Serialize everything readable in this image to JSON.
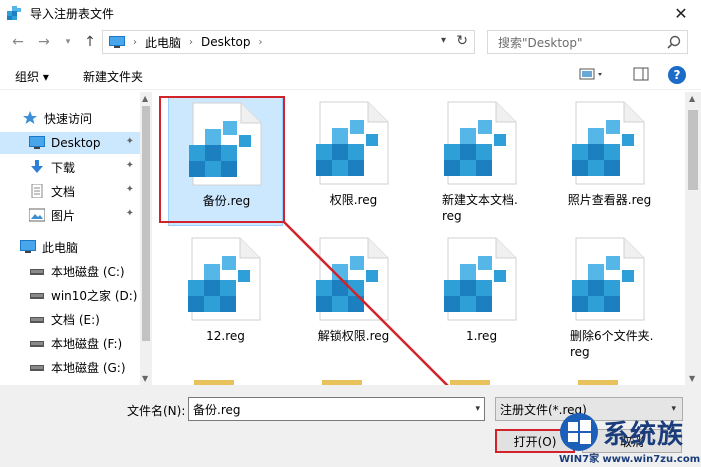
{
  "window": {
    "title": "导入注册表文件",
    "close_glyph": "✕"
  },
  "address": {
    "crumbs": [
      "此电脑",
      "Desktop"
    ]
  },
  "search": {
    "placeholder": "搜索\"Desktop\""
  },
  "toolbar": {
    "organize": "组织 ▾",
    "new_folder": "新建文件夹",
    "help": "?"
  },
  "sidebar": {
    "items": [
      {
        "label": "快速访问",
        "icon": "star-icon"
      },
      {
        "label": "Desktop",
        "icon": "desktop-icon",
        "selected": true
      },
      {
        "label": "下载",
        "icon": "download-icon"
      },
      {
        "label": "文档",
        "icon": "document-icon"
      },
      {
        "label": "图片",
        "icon": "picture-icon"
      },
      {
        "label": "此电脑",
        "icon": "computer-icon"
      },
      {
        "label": "本地磁盘 (C:)",
        "icon": "drive-icon"
      },
      {
        "label": "win10之家 (D:)",
        "icon": "drive-icon"
      },
      {
        "label": "文档 (E:)",
        "icon": "drive-icon"
      },
      {
        "label": "本地磁盘 (F:)",
        "icon": "drive-icon"
      },
      {
        "label": "本地磁盘 (G:)",
        "icon": "drive-icon"
      }
    ]
  },
  "files": [
    {
      "name": "备份.reg",
      "selected": true
    },
    {
      "name": "权限.reg"
    },
    {
      "name": "新建文本文档.\nreg"
    },
    {
      "name": "照片查看器.reg"
    },
    {
      "name": "12.reg"
    },
    {
      "name": "解锁权限.reg"
    },
    {
      "name": "1.reg"
    },
    {
      "name": "删除6个文件夹.\nreg"
    }
  ],
  "bottom": {
    "filename_label": "文件名(N):",
    "filename_value": "备份.reg",
    "filetype_value": "注册文件(*.reg)",
    "open_label": "打开(O)",
    "cancel_label": "取消"
  },
  "watermark": {
    "brand": "系统族",
    "url": "WIN7家 www.win7zu.com"
  },
  "colors": {
    "accent": "#0078d7",
    "selected_bg": "#cce8ff",
    "highlight": "#d3232a",
    "reg_blue": "#2f9fd8"
  }
}
